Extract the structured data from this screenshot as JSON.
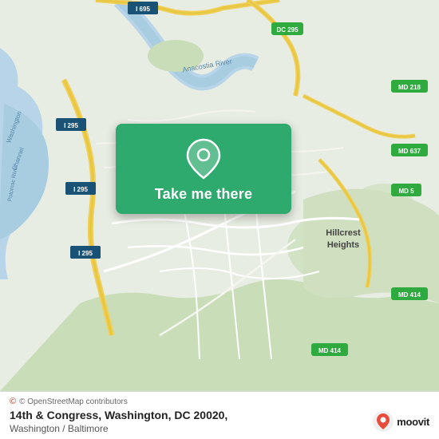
{
  "map": {
    "alt": "Street map of Washington DC area showing 14th and Congress intersection"
  },
  "card": {
    "label": "Take me there",
    "pin_icon": "map-pin"
  },
  "bottom": {
    "attribution": "© OpenStreetMap contributors",
    "location_line1": "14th & Congress, Washington, DC 20020,",
    "location_line2": "Washington / Baltimore"
  },
  "branding": {
    "name": "moovit"
  }
}
